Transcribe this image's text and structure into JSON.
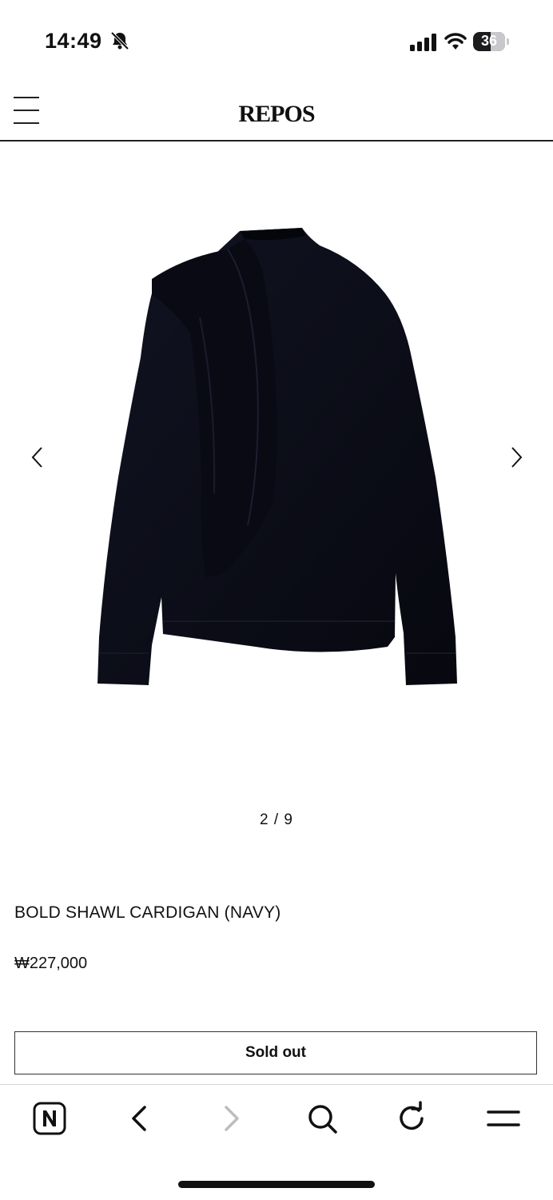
{
  "status_bar": {
    "time": "14:49",
    "battery": "36",
    "icons": [
      "bell-slash-icon",
      "cellular-signal-icon",
      "wifi-icon",
      "battery-icon"
    ]
  },
  "header": {
    "brand": "REPOS",
    "menu_icon": "hamburger-menu-icon"
  },
  "gallery": {
    "image_alt": "navy sweater with draped shawl",
    "prev_icon": "chevron-left-icon",
    "next_icon": "chevron-right-icon",
    "counter": "2 / 9"
  },
  "product": {
    "name": "BOLD SHAWL CARDIGAN (NAVY)",
    "price": "₩227,000",
    "button_label": "Sold out"
  },
  "browser_toolbar": {
    "items": [
      "naver-home-icon",
      "back-icon",
      "forward-icon",
      "search-icon",
      "reload-icon",
      "menu-icon"
    ],
    "forward_disabled_color": "#bdbdbd"
  },
  "colors": {
    "garment": "#0b0c16",
    "text": "#111111"
  }
}
